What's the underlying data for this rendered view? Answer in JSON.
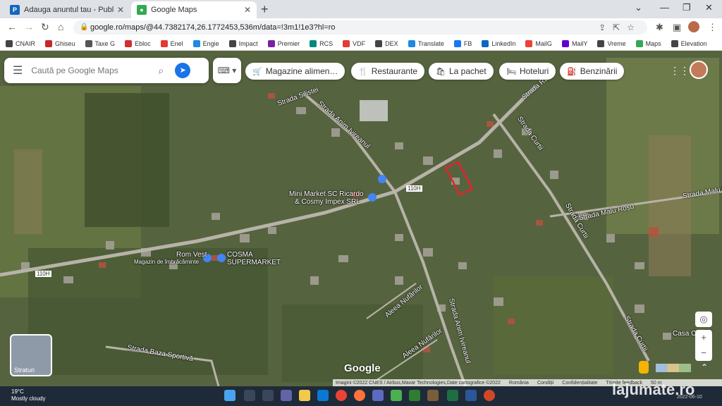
{
  "browser": {
    "tabs": [
      {
        "title": "Adauga anuntul tau - Publi24",
        "icon": "publi24-icon",
        "color": "#1565c0"
      },
      {
        "title": "Google Maps",
        "icon": "google-maps-icon",
        "color": "#34a853"
      }
    ],
    "url": "google.ro/maps/@44.7382174,26.1772453,536m/data=!3m1!1e3?hl=ro"
  },
  "bookmarks": [
    {
      "label": "CNAIR",
      "color": "#444"
    },
    {
      "label": "Ghiseu",
      "color": "#c62828"
    },
    {
      "label": "Taxe G",
      "color": "#555"
    },
    {
      "label": "Ebloc",
      "color": "#d32f2f"
    },
    {
      "label": "Enel",
      "color": "#e53935"
    },
    {
      "label": "Engie",
      "color": "#1e88e5"
    },
    {
      "label": "Impact",
      "color": "#444"
    },
    {
      "label": "Premier",
      "color": "#7b1fa2"
    },
    {
      "label": "RCS",
      "color": "#00897b"
    },
    {
      "label": "VDF",
      "color": "#e53935"
    },
    {
      "label": "DEX",
      "color": "#444"
    },
    {
      "label": "Translate",
      "color": "#1e88e5"
    },
    {
      "label": "FB",
      "color": "#1877f2"
    },
    {
      "label": "LinkedIn",
      "color": "#0a66c2"
    },
    {
      "label": "MailG",
      "color": "#ea4335"
    },
    {
      "label": "MailY",
      "color": "#6001d2"
    },
    {
      "label": "Vreme",
      "color": "#444"
    },
    {
      "label": "Maps",
      "color": "#34a853"
    },
    {
      "label": "Elevation",
      "color": "#444"
    }
  ],
  "maps": {
    "search_placeholder": "Caută pe Google Maps",
    "chips": [
      {
        "label": "Magazine alimen…",
        "icon": "🛒"
      },
      {
        "label": "Restaurante",
        "icon": "🍴"
      },
      {
        "label": "La pachet",
        "icon": "🛍"
      },
      {
        "label": "Hoteluri",
        "icon": "🛏"
      },
      {
        "label": "Benzinării",
        "icon": "⛽"
      }
    ],
    "labels": {
      "strada_silistei": "Strada Silistei",
      "strada_anim": "Strada Anim Ivireanul",
      "strada_ras": "Strada Răs",
      "strada_curtii_1": "Strada Curtii",
      "strada_curtii_2": "Strada Curtii",
      "strada_curtii_3": "Strada Curtii",
      "strada_malu": "Strada Malu Roșu",
      "strada_malu_r": "Strada Malu R",
      "mini_market": "Mini Market SC Ricardo",
      "mini_market_2": "& Cosmy Impex SRL",
      "cosma": "COSMA",
      "supermarket": "SUPERMARKET",
      "rom_vest": "Rom Vest",
      "magazin": "Magazin de îmbrăcăminte",
      "road_110h_1": "110H",
      "road_110h_2": "110H",
      "aleea_1": "Aleea Nufărilor",
      "aleea_2": "Aleea Nufărilor",
      "strada_anim_2": "Strada Anim Ivireanul",
      "baza": "Strada Baza Sportivă",
      "casa": "Casa C... Sil"
    },
    "layers_label": "Straturi",
    "google_logo": "Google",
    "attribution": [
      "Imagini ©2022 CNES / Airbus,Maxar Technologies,Date cartografice ©2022",
      "România",
      "Condiții",
      "Confidențialitate",
      "Trimite feedback",
      "50 m"
    ]
  },
  "taskbar": {
    "temp": "19°C",
    "weather": "Mostly cloudy",
    "date": "2022-06-10"
  },
  "watermark": "lajumate.ro"
}
